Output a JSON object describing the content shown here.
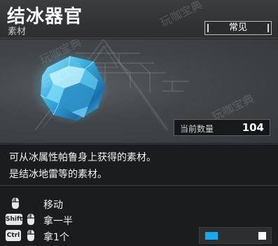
{
  "item": {
    "name": "结冰器官",
    "category": "素材",
    "rarity": "常见",
    "owned_label": "当前数量",
    "owned_count": "104",
    "image_icon": "ice-crystal-icon"
  },
  "description": {
    "line1": "可从冰属性帕鲁身上获得的素材。",
    "line2": "是结冰地雷等的素材。"
  },
  "controls": [
    {
      "key": "",
      "icon": "mouse-left-click-icon",
      "label": "移动"
    },
    {
      "key": "Shift",
      "icon": "mouse-left-click-icon",
      "label": "拿一半"
    },
    {
      "key": "Ctrl",
      "icon": "mouse-left-click-icon",
      "label": "拿1个"
    }
  ],
  "stepper": {
    "accent_color": "#18a8f0"
  },
  "watermarks": [
    "玩咖宝典",
    "玩咖宝典",
    "玩咖宝典",
    "玩咖宝典"
  ]
}
